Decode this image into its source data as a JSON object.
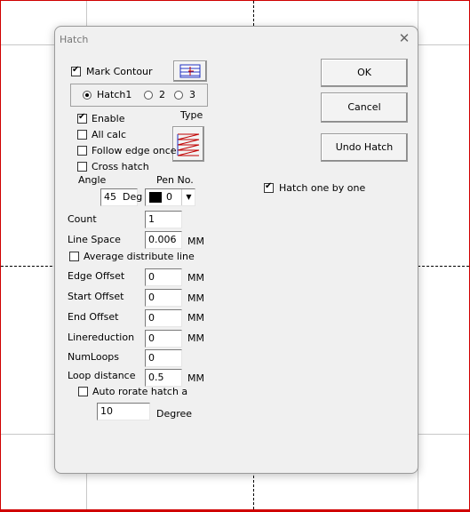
{
  "dialog": {
    "title": "Hatch",
    "close_glyph": "✕",
    "buttons": {
      "ok": "OK",
      "cancel": "Cancel",
      "undo": "Undo Hatch"
    },
    "mark_contour": {
      "label": "Mark Contour",
      "checked": true
    },
    "hatch_tabs": {
      "items": [
        "Hatch1",
        "2",
        "3"
      ],
      "selected": "Hatch1"
    },
    "enable": {
      "label": "Enable",
      "checked": true
    },
    "all_calc": {
      "label": "All calc",
      "checked": false
    },
    "follow_edge_once": {
      "label": "Follow edge once",
      "checked": false
    },
    "cross_hatch": {
      "label": "Cross hatch",
      "checked": false
    },
    "type_label": "Type",
    "angle": {
      "label": "Angle",
      "value": "45",
      "unit": "Deg"
    },
    "pen": {
      "label": "Pen No.",
      "value": "0",
      "color": "#000000"
    },
    "hatch_one_by_one": {
      "label": "Hatch one by one",
      "checked": true
    },
    "count": {
      "label": "Count",
      "value": "1"
    },
    "line_space": {
      "label": "Line Space",
      "value": "0.006",
      "unit": "MM"
    },
    "average_distribute": {
      "label": "Average distribute line",
      "checked": false
    },
    "edge_offset": {
      "label": "Edge Offset",
      "value": "0",
      "unit": "MM"
    },
    "start_offset": {
      "label": "Start Offset",
      "value": "0",
      "unit": "MM"
    },
    "end_offset": {
      "label": "End Offset",
      "value": "0",
      "unit": "MM"
    },
    "linereduction": {
      "label": "Linereduction",
      "value": "0",
      "unit": "MM"
    },
    "num_loops": {
      "label": "NumLoops",
      "value": "0"
    },
    "loop_distance": {
      "label": "Loop distance",
      "value": "0.5",
      "unit": "MM"
    },
    "auto_rotate": {
      "label": "Auto rorate hatch angle",
      "checked": false
    },
    "degree": {
      "value": "10",
      "unit": "Degree"
    }
  },
  "colors": {
    "canvas_border": "#d00000",
    "grid": "#c8c8c8",
    "icon_accent": "#c00000",
    "icon_blue": "#2030c0"
  }
}
